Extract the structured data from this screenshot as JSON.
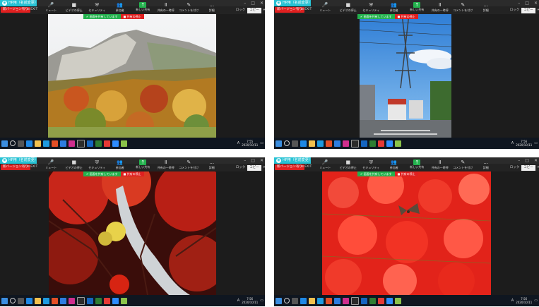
{
  "window": {
    "title": "HP用（名前変更）",
    "app_icon": "app-logo-icon"
  },
  "header": {
    "version_badge": "新バージョン有り",
    "exit_label": "EXIT"
  },
  "toolbar": [
    {
      "label": "ミュート",
      "icon": "🎤"
    },
    {
      "label": "ビデオの停止",
      "icon": "■"
    },
    {
      "label": "セキュリティ",
      "icon": "⛨"
    },
    {
      "label": "参加者",
      "icon": "👥"
    },
    {
      "label": "新しい共有",
      "icon": "↑"
    },
    {
      "label": "共有の一時停",
      "icon": "Ⅱ"
    },
    {
      "label": "コメントを付け",
      "icon": "✎"
    },
    {
      "label": "詳細",
      "icon": "…"
    }
  ],
  "right_controls": {
    "more": "コピー",
    "record": "ロック"
  },
  "banner": {
    "sharing_text": "画面を共有しています",
    "stop_share": "共有の停止"
  },
  "screenshots": [
    {
      "time": "7:55",
      "date": "2020/10/11",
      "scene": "mountain"
    },
    {
      "time": "7:56",
      "date": "2020/10/11",
      "scene": "street"
    },
    {
      "time": "7:56",
      "date": "2020/10/11",
      "scene": "waterfall"
    },
    {
      "time": "7:56",
      "date": "2020/10/11",
      "scene": "flowers"
    }
  ],
  "taskbar": {
    "ime_label": "A"
  }
}
